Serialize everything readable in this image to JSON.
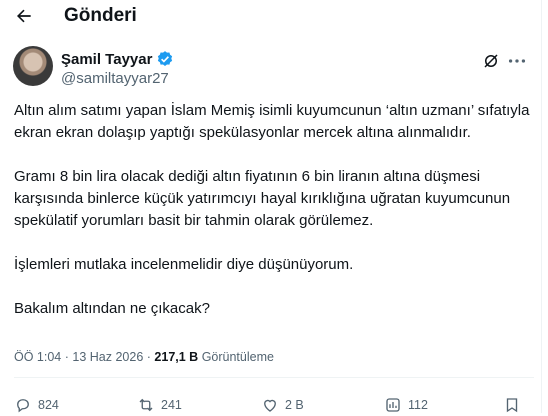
{
  "header": {
    "title": "Gönderi"
  },
  "author": {
    "display_name": "Şamil Tayyar",
    "handle": "@samiltayyar27"
  },
  "post": {
    "paragraphs": [
      "Altın alım satımı yapan İslam Memiş isimli kuyumcunun ‘altın uzmanı’ sıfatıyla ekran ekran dolaşıp yaptığı spekülasyonlar mercek altına alınmalıdır.",
      "Gramı 8 bin lira olacak dediği altın fiyatının 6 bin liranın altına düşmesi karşısında binlerce küçük yatırımcıyı hayal kırıklığına uğratan kuyumcunun spekülatif yorumları basit bir tahmin olarak görülemez.",
      "İşlemleri mutlaka incelenmelidir diye düşünüyorum.",
      "Bakalım altından ne çıkacak?"
    ]
  },
  "meta": {
    "time": "ÖÖ 1:04",
    "separator": "·",
    "date": "13 Haz 2026",
    "views_count": "217,1 B",
    "views_label": "Görüntüleme"
  },
  "actions": {
    "replies": "824",
    "reposts": "241",
    "likes": "2 B",
    "views": "112"
  },
  "colors": {
    "verified": "#1d9bf0",
    "muted": "#536471",
    "text": "#0f1419"
  },
  "icons": [
    "back-arrow-icon",
    "verified-badge-icon",
    "grok-icon",
    "more-icon",
    "reply-icon",
    "repost-icon",
    "like-icon",
    "views-icon",
    "bookmark-icon"
  ]
}
